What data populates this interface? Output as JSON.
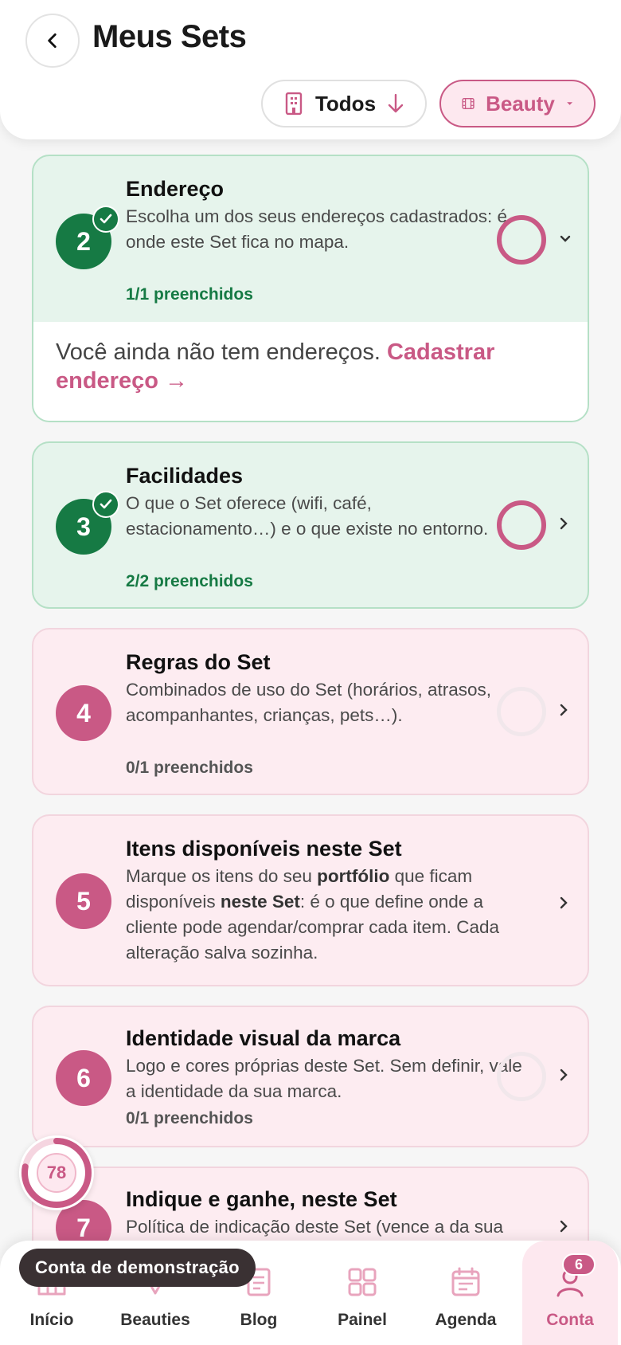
{
  "header": {
    "title": "Meus Sets",
    "filter_todos": "Todos",
    "filter_beauty": "Beauty"
  },
  "steps": [
    {
      "number": "2",
      "title": "Endereço",
      "description": "Escolha um dos seus endereços cadastrados: é onde este Set fica no mapa.",
      "progress": "1/1 preenchidos",
      "status": "complete",
      "expanded": true,
      "empty_text": "Você ainda não tem endereços.",
      "empty_link": "Cadastrar endereço →"
    },
    {
      "number": "3",
      "title": "Facilidades",
      "description": "O que o Set oferece (wifi, café, estacionamento…) e o que existe no entorno.",
      "progress": "2/2 preenchidos",
      "status": "complete"
    },
    {
      "number": "4",
      "title": "Regras do Set",
      "description": "Combinados de uso do Set (horários, atrasos, acompanhantes, crianças, pets…).",
      "progress": "0/1 preenchidos",
      "status": "pending"
    },
    {
      "number": "5",
      "title": "Itens disponíveis neste Set",
      "description_parts": [
        "Marque os itens do seu ",
        "portfólio",
        " que ficam disponíveis ",
        "neste Set",
        ": é o que define onde a cliente pode agendar/comprar cada item. Cada alteração salva sozinha."
      ],
      "status": "pending"
    },
    {
      "number": "6",
      "title": "Identidade visual da marca",
      "description": "Logo e cores próprias deste Set. Sem definir, vale a identidade da sua marca.",
      "progress": "0/1 preenchidos",
      "status": "pending"
    },
    {
      "number": "7",
      "title": "Indique e ganhe, neste Set",
      "description": "Política de indicação deste Set (vence a da sua",
      "status": "pending"
    }
  ],
  "score": {
    "value": "78",
    "fraction": 0.78
  },
  "demo_label": "Conta de demonstração",
  "nav": [
    {
      "label": "Início",
      "icon": "home-icon"
    },
    {
      "label": "Beauties",
      "icon": "beauties-icon"
    },
    {
      "label": "Blog",
      "icon": "blog-icon"
    },
    {
      "label": "Painel",
      "icon": "dashboard-icon"
    },
    {
      "label": "Agenda",
      "icon": "calendar-icon"
    },
    {
      "label": "Conta",
      "icon": "user-icon",
      "active": true,
      "badge": "6"
    }
  ],
  "colors": {
    "brand": "#c95985",
    "success": "#167a44",
    "success_bg": "#e6f4ec",
    "pending_bg": "#fdecf1"
  }
}
